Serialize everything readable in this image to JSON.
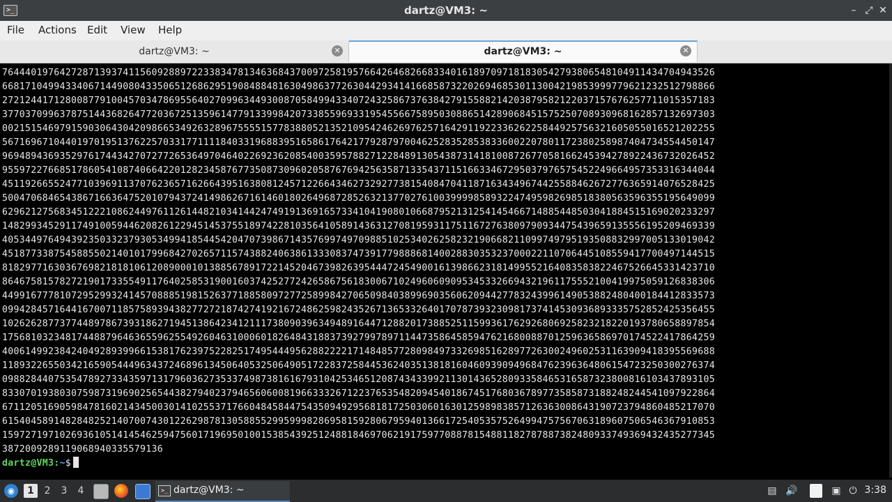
{
  "window": {
    "title": "dartz@VM3: ~",
    "app_icon": "terminal-icon",
    "controls": {
      "minimize": "–",
      "restore": "✕",
      "close": "✕"
    }
  },
  "menu": {
    "file": "File",
    "actions": "Actions",
    "edit": "Edit",
    "view": "View",
    "help": "Help"
  },
  "tabs": [
    {
      "label": "dartz@VM3: ~",
      "active": false
    },
    {
      "label": "dartz@VM3: ~",
      "active": true
    }
  ],
  "terminal": {
    "output": [
      "7644401976427287139374115609288972233834781346368437009725819576642646826683340161897097181830542793806548104911434704943526",
      "6681710499433406714490804335065126862951908488481630498637726304429341416685873220269468530113004219853999779621232512798866",
      "2721244171280087791004570347869556402709963449300870584994334072432586737638427915588214203879582122037157676257711015357183",
      "3770370996378751443682647720367251359614779133998420733855969331954556675895030886514289068451575250708930968162857132697303",
      "0021515469791590306430420986653492632896755551577838805213521095424626976257164291192233626225844925756321605055016521202255",
      "5671696710440197019513762257033177111184033196883951658617642177928797004625283528538336002207801172380258987404734554450147",
      "9694894369352976174434270727726536497046402269236208540035957882712284891305438731418100872677058166245394278922436732026452",
      "9559722766851786054108740664220128234587677350873096020587676942563587133543711516633467295037976575452249664957353316344044",
      "4511926655247710396911370762365716266439516380812457122664346273292773815408470411871634349674425588462672776365914076528425",
      "5004706846543867166364752010794372414986267161460180264968728526321377027610039999858932247495982698518380563596355195649099",
      "6296212756834512221086244976112614482103414424749191369165733410419080106687952131254145466714885448503041884515169020233297",
      "1482993452911749100594462082612294514537551897422810356410589143631270819593117511672763809790934475439659135556195209469339",
      "4053449764943923503323793053499418544542047073986714357699749709885102534026258232190668211099749795193508832997005133019042",
      "4518773387545885502140101799684270265711574388240638613330837473917798886814002883035323700022110706445108559417700497144515",
      "8182977163036769821818106120890001013885678917221452046739826395444724549001613986623181499552164083583822467526645331423710",
      "8646758157827219017335549117640258531900160374252772426586756183006710249606090953453326694321961175552100419975059126838306",
      "4499167778107295299324145708885198152637718858097277258998427065098403899690356062094427783243996149053882480400184412833573",
      "0994284571644167007118575893943827727218742741921672486259824352671365332640170787393230981737414530936893335752852425356455",
      "1026262877377448978673931862719451386423412111738090396349489164471288201738852511599361762926806925823218220193780658897854",
      "1756810323481744887964636559625549260463100060182648431883739279978971144735864585947621680088701259636586970174522417864259",
      "4006149923842404928939966153817623975228251749544495628822221714848577280984973326985162897726300249602531163909418395569688",
      "1189322655034216590544496343724689613450640532506490517228372584453624035138181604609390949684762396364806154723250300276374",
      "0988284407535478927334359713179603627353374987381616793104253465120874343399211301436528093358465316587323800816103437893105",
      "8330701938030759873196902565443827940237946560600819663332671223765354820945401867451768036789773585873188248244541097922864",
      "6711205169059847816021434500301410255371766048458447543509492956818172503060163012598983857126363008643190723794860485217070",
      "6154045891482848252140700743012262987813058855299599982869581592806795940136617254053575264994757567063189607506546367910853",
      "1597271971026936105141454625947560171969501001538543925124881846970621917597708878154881182787887382480933749369432435277345",
      "387200928911906894033557913 6"
    ],
    "prompt_user": "dartz@VM3",
    "prompt_sep": ":",
    "prompt_path": "~",
    "prompt_symbol": "$"
  },
  "taskbar": {
    "start_icon": "lubuntu-logo-icon",
    "workspaces": [
      "1",
      "2",
      "3",
      "4"
    ],
    "active_workspace": "1",
    "quicklaunch": [
      "file-manager-icon",
      "firefox-icon",
      "desktop-icon"
    ],
    "task_label": "dartz@VM3: ~",
    "tray": [
      "removable-drive-icon",
      "volume-icon",
      "clipboard-icon",
      "network-icon",
      "power-icon"
    ],
    "clock": "3:38"
  },
  "colors": {
    "terminal_bg": "#000000",
    "terminal_fg": "#e6e6e6",
    "prompt_user": "#5fd75f",
    "prompt_path": "#6aa8ff",
    "titlebar_bg": "#3c3f41",
    "taskbar_bg": "#2b2d2e"
  }
}
